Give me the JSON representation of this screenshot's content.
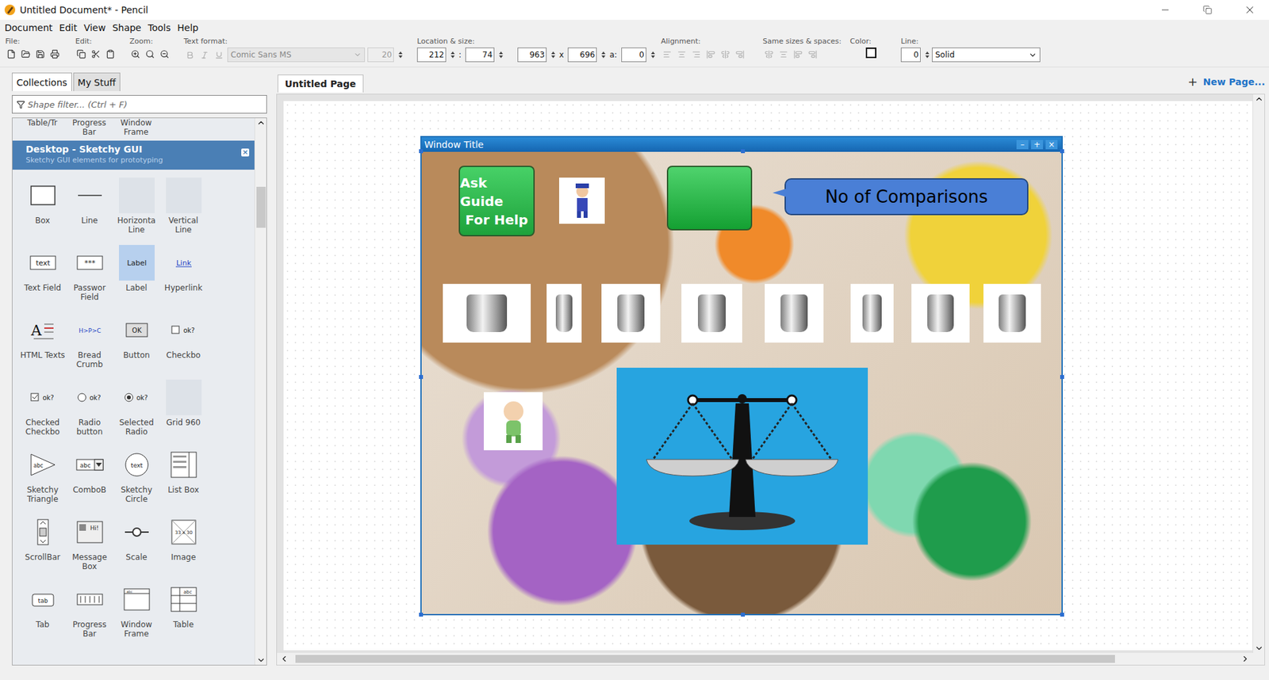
{
  "window": {
    "title": "Untitled Document* - Pencil"
  },
  "menu": [
    "Document",
    "Edit",
    "View",
    "Shape",
    "Tools",
    "Help"
  ],
  "toolbar": {
    "file": "File:",
    "edit": "Edit:",
    "zoom": "Zoom:",
    "textFormat": {
      "label": "Text format:",
      "font": "Comic Sans MS",
      "size": "20"
    },
    "location": {
      "label": "Location & size:",
      "x": "212",
      "sep": ":",
      "y": "74",
      "w": "963",
      "times": "x",
      "h": "696",
      "angleLabel": "a:",
      "angle": "0"
    },
    "alignment": "Alignment:",
    "sameSizes": "Same sizes & spaces:",
    "color": "Color:",
    "line": {
      "label": "Line:",
      "width": "0",
      "style": "Solid"
    }
  },
  "panel": {
    "tabs": [
      {
        "label": "Collections",
        "selected": true
      },
      {
        "label": "My Stuff",
        "selected": false
      }
    ],
    "filterPlaceholder": "Shape filter... (Ctrl + F)",
    "partialShapes": [
      "Table/Tr",
      "Progress Bar",
      "Window Frame"
    ],
    "collection": {
      "title": "Desktop - Sketchy GUI",
      "subtitle": "Sketchy GUI elements for prototyping",
      "close": "×"
    },
    "shapes": [
      {
        "label": "Box",
        "kind": "box",
        "glyph": "",
        "selected": false
      },
      {
        "label": "Line",
        "kind": "line",
        "glyph": "",
        "selected": false
      },
      {
        "label": "Horizonta Line",
        "kind": "blank",
        "glyph": "",
        "selected": false
      },
      {
        "label": "Vertical Line",
        "kind": "blank",
        "glyph": "",
        "selected": false
      },
      {
        "label": "Text Field",
        "kind": "field",
        "glyph": "text",
        "selected": false
      },
      {
        "label": "Passwor Field",
        "kind": "field",
        "glyph": "***",
        "selected": false
      },
      {
        "label": "Label",
        "kind": "label",
        "glyph": "Label",
        "selected": true
      },
      {
        "label": "Hyperlink",
        "kind": "link",
        "glyph": "Link",
        "selected": false
      },
      {
        "label": "HTML Texts",
        "kind": "html",
        "glyph": "A",
        "selected": false
      },
      {
        "label": "Bread Crumb",
        "kind": "crumb",
        "glyph": "H>P>C",
        "selected": false
      },
      {
        "label": "Button",
        "kind": "button",
        "glyph": "OK",
        "selected": false
      },
      {
        "label": "Checkbo",
        "kind": "checkbox",
        "glyph": "ok?",
        "selected": false
      },
      {
        "label": "Checked Checkbo",
        "kind": "checked",
        "glyph": "ok?",
        "selected": false
      },
      {
        "label": "Radio button",
        "kind": "radio",
        "glyph": "ok?",
        "selected": false
      },
      {
        "label": "Selected Radio",
        "kind": "selradio",
        "glyph": "ok?",
        "selected": false
      },
      {
        "label": "Grid 960",
        "kind": "blank",
        "glyph": "",
        "selected": false
      },
      {
        "label": "Sketchy Triangle",
        "kind": "triangle",
        "glyph": "abc",
        "selected": false
      },
      {
        "label": "ComboB",
        "kind": "combo",
        "glyph": "abc",
        "selected": false
      },
      {
        "label": "Sketchy Circle",
        "kind": "circle",
        "glyph": "text",
        "selected": false
      },
      {
        "label": "List Box",
        "kind": "listbox",
        "glyph": "",
        "selected": false
      },
      {
        "label": "ScrollBar",
        "kind": "scrollbar",
        "glyph": "",
        "selected": false
      },
      {
        "label": "Message Box",
        "kind": "message",
        "glyph": "Hi!",
        "selected": false
      },
      {
        "label": "Scale",
        "kind": "scale",
        "glyph": "",
        "selected": false
      },
      {
        "label": "Image",
        "kind": "image",
        "glyph": "33 x 30",
        "selected": false
      },
      {
        "label": "Tab",
        "kind": "tab",
        "glyph": "tab",
        "selected": false
      },
      {
        "label": "Progress Bar",
        "kind": "progress",
        "glyph": "",
        "selected": false
      },
      {
        "label": "Window Frame",
        "kind": "window",
        "glyph": "abc",
        "selected": false
      },
      {
        "label": "Table",
        "kind": "table",
        "glyph": "abc",
        "selected": false
      }
    ]
  },
  "pages": {
    "tabs": [
      {
        "label": "Untitled Page",
        "selected": true
      }
    ],
    "addIcon": "+",
    "newPage": "New Page..."
  },
  "canvas": {
    "frame": {
      "title": "Window Title",
      "controls": [
        "–",
        "+",
        "×"
      ]
    },
    "askButton": [
      "Ask Guide",
      "For Help"
    ],
    "callout": "No of Comparisons"
  }
}
